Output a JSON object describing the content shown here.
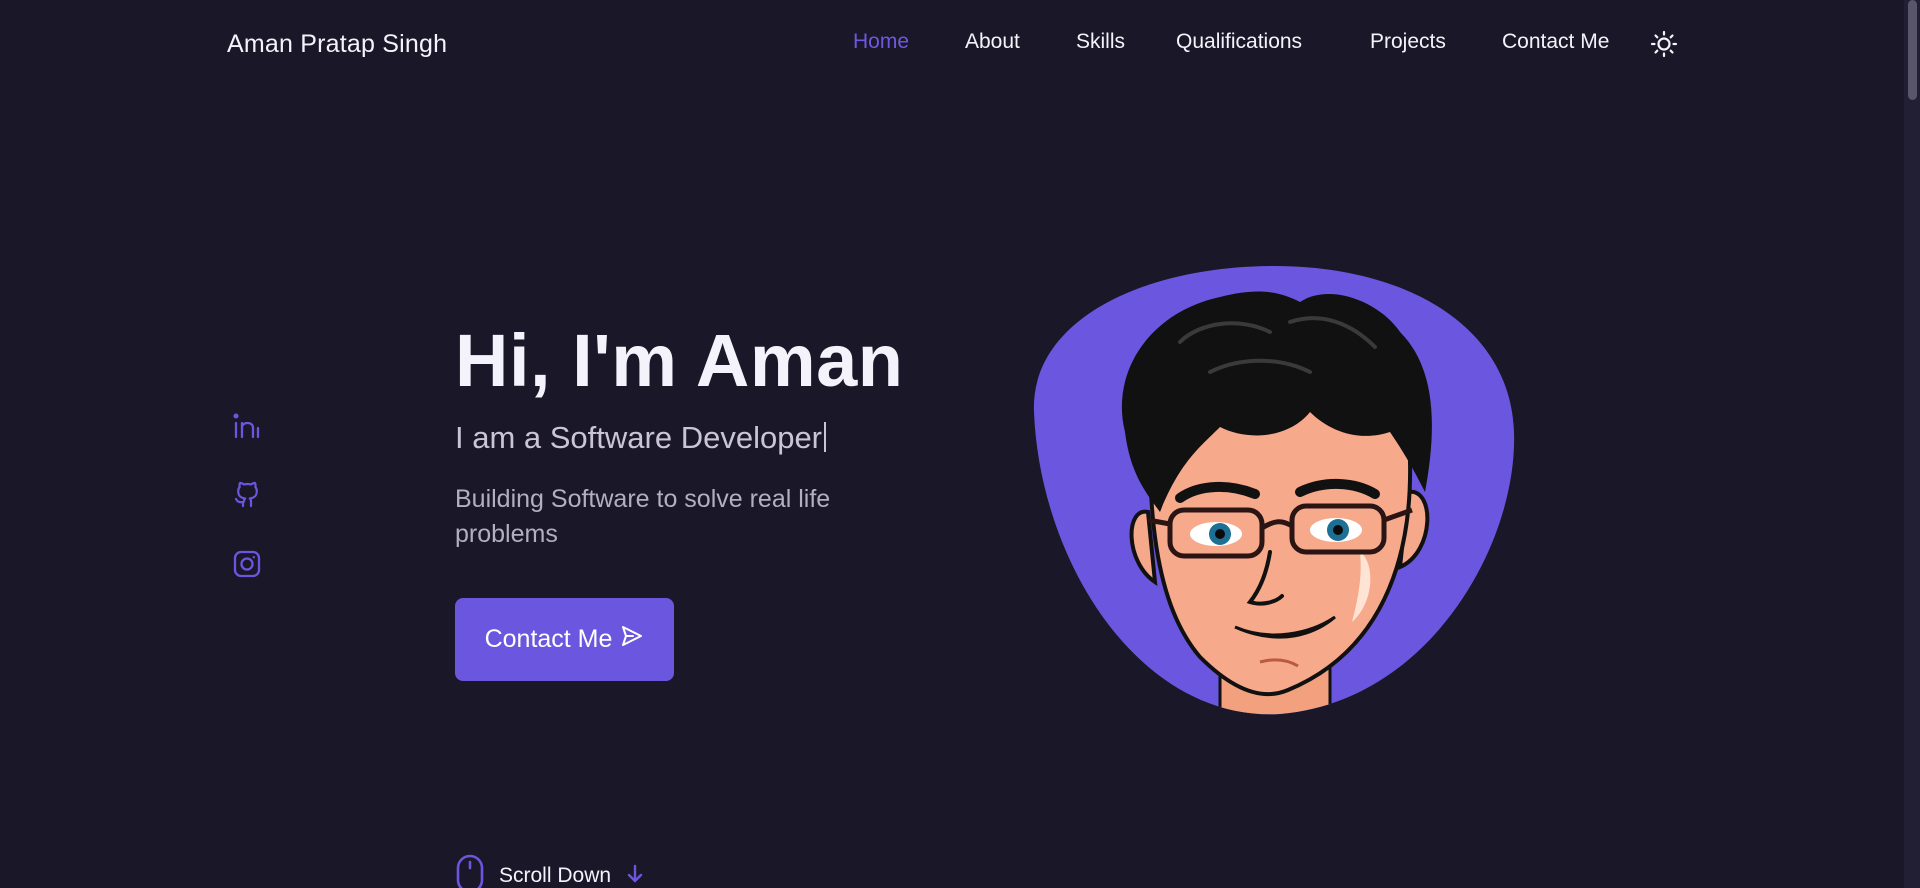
{
  "header": {
    "logo": "Aman Pratap Singh",
    "nav": [
      {
        "label": "Home",
        "active": true
      },
      {
        "label": "About",
        "active": false
      },
      {
        "label": "Skills",
        "active": false
      },
      {
        "label": "Qualifications",
        "active": false
      },
      {
        "label": "Projects",
        "active": false
      },
      {
        "label": "Contact Me",
        "active": false
      }
    ],
    "theme_icon": "sun-icon"
  },
  "social": [
    {
      "name": "linkedin-icon"
    },
    {
      "name": "github-icon"
    },
    {
      "name": "instagram-icon"
    }
  ],
  "hero": {
    "title": "Hi, I'm Aman",
    "subtitle": "I am a Software Developer",
    "description": "Building Software to solve real life problems",
    "button_label": "Contact Me",
    "button_icon": "send-icon"
  },
  "scroll": {
    "label": "Scroll Down",
    "icons": [
      "mouse-icon",
      "arrow-down-icon"
    ]
  },
  "colors": {
    "background": "#1a1728",
    "accent": "#6b56df",
    "text": "#f4f2fa",
    "muted_text": "#b3afc2"
  }
}
